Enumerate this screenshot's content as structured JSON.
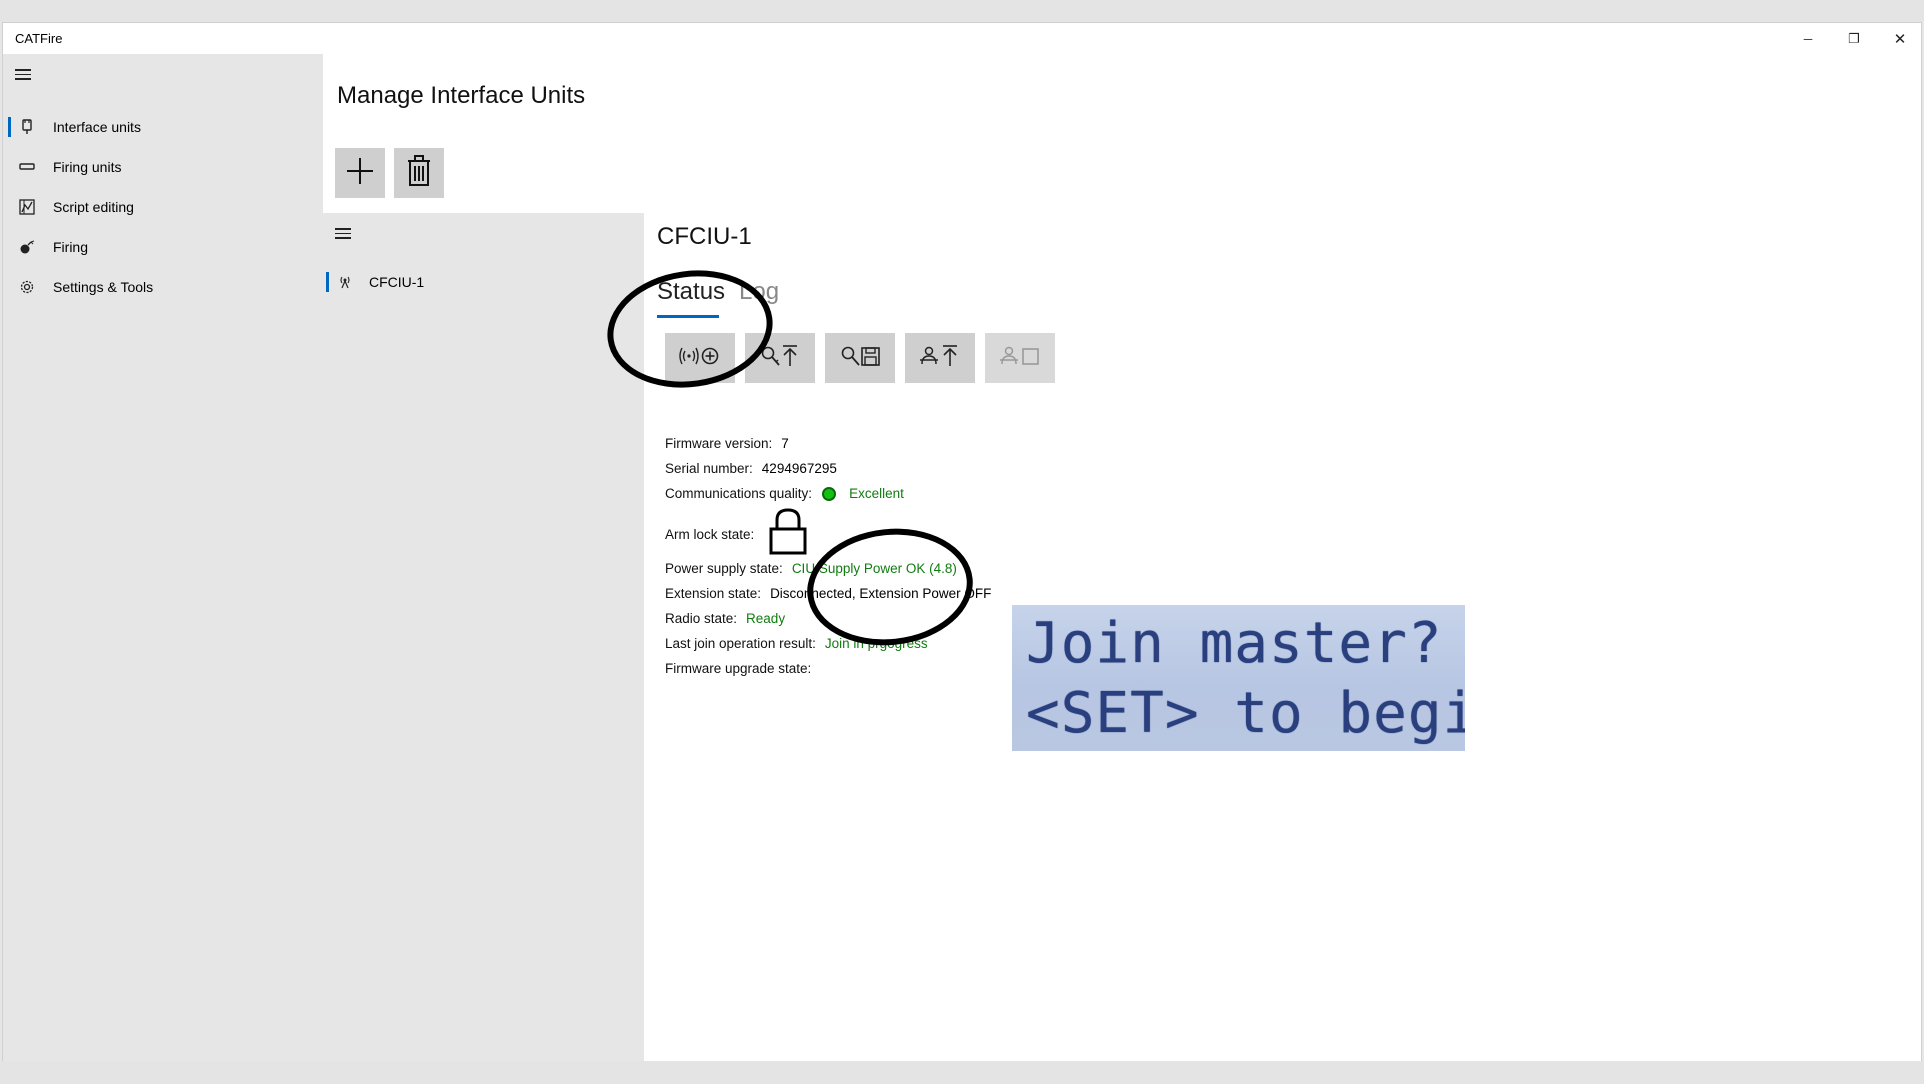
{
  "window": {
    "title": "CATFire",
    "minimize_glyph": "─",
    "restore_glyph": "❐",
    "close_glyph": "✕"
  },
  "sidebar": {
    "items": [
      {
        "label": "Interface units",
        "icon": "interface-unit-icon",
        "selected": true
      },
      {
        "label": "Firing units",
        "icon": "firing-unit-icon",
        "selected": false
      },
      {
        "label": "Script editing",
        "icon": "script-editing-icon",
        "selected": false
      },
      {
        "label": "Firing",
        "icon": "firing-icon",
        "selected": false
      },
      {
        "label": "Settings & Tools",
        "icon": "gear-icon",
        "selected": false
      }
    ]
  },
  "main": {
    "title": "Manage Interface Units",
    "commands": [
      {
        "icon": "add-icon"
      },
      {
        "icon": "delete-icon"
      }
    ],
    "units": [
      {
        "label": "CFCIU-1",
        "icon": "antenna-icon",
        "selected": true
      }
    ]
  },
  "detail": {
    "unit_name": "CFCIU-1",
    "tabs": [
      {
        "label": "Status",
        "selected": true
      },
      {
        "label": "Log",
        "selected": false
      }
    ],
    "actions": [
      {
        "icon": "join-radio-icon",
        "enabled": true
      },
      {
        "icon": "key-upload-icon",
        "enabled": true
      },
      {
        "icon": "key-save-icon",
        "enabled": true
      },
      {
        "icon": "firmware-upload-icon",
        "enabled": true
      },
      {
        "icon": "unit-stop-icon",
        "enabled": false
      }
    ],
    "status": {
      "firmware_version_label": "Firmware version:",
      "firmware_version": "7",
      "serial_label": "Serial number:",
      "serial": "4294967295",
      "comms_label": "Communications quality:",
      "comms": "Excellent",
      "arm_label": "Arm lock state:",
      "power_label": "Power supply state:",
      "power": "CIU Supply Power OK (4.8)",
      "extension_label": "Extension state:",
      "extension": "Disconnected, Extension Power OFF",
      "radio_label": "Radio state:",
      "radio": "Ready",
      "join_label": "Last join operation result:",
      "join": "Join in prgogress",
      "fw_upgrade_label": "Firmware upgrade state:"
    },
    "lcd": {
      "line1": "Join master?",
      "line2": "<SET> to begin"
    }
  },
  "colors": {
    "accent": "#0067c0",
    "status_green": "#107c10",
    "sidebar_bg": "#e6e6e6",
    "button_bg": "#cfcfcf"
  }
}
